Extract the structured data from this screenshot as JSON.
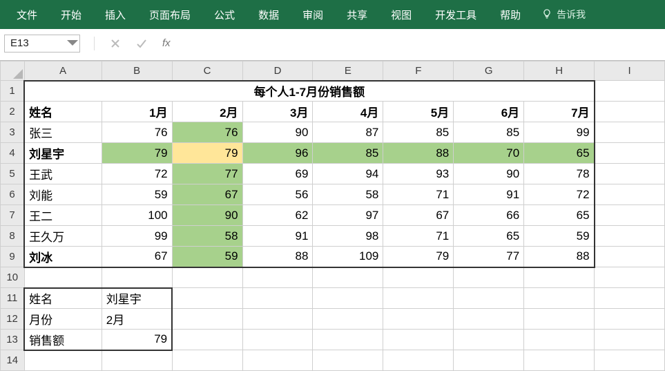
{
  "menu": {
    "items": [
      "文件",
      "开始",
      "插入",
      "页面布局",
      "公式",
      "数据",
      "审阅",
      "共享",
      "视图",
      "开发工具",
      "帮助"
    ],
    "tell_me": "告诉我"
  },
  "formula_bar": {
    "name_box": "E13",
    "fx_label": "fx",
    "formula": ""
  },
  "columns": [
    "A",
    "B",
    "C",
    "D",
    "E",
    "F",
    "G",
    "H",
    "I"
  ],
  "rows_count": 14,
  "title_row": {
    "text": "每个人1-7月份销售额"
  },
  "header_row": {
    "name_label": "姓名",
    "months": [
      "1月",
      "2月",
      "3月",
      "4月",
      "5月",
      "6月",
      "7月"
    ]
  },
  "data_rows": [
    {
      "name": "张三",
      "values": [
        76,
        76,
        90,
        87,
        85,
        85,
        99
      ]
    },
    {
      "name": "刘星宇",
      "values": [
        79,
        79,
        96,
        85,
        88,
        70,
        65
      ]
    },
    {
      "name": "王武",
      "values": [
        72,
        77,
        69,
        94,
        93,
        90,
        78
      ]
    },
    {
      "name": "刘能",
      "values": [
        59,
        67,
        56,
        58,
        71,
        91,
        72
      ]
    },
    {
      "name": "王二",
      "values": [
        100,
        90,
        62,
        97,
        67,
        66,
        65
      ]
    },
    {
      "name": "王久万",
      "values": [
        99,
        58,
        91,
        98,
        71,
        65,
        59
      ]
    },
    {
      "name": "刘冰",
      "values": [
        67,
        59,
        88,
        109,
        79,
        77,
        88
      ]
    }
  ],
  "highlight": {
    "green_column_index": 1,
    "green_row_index": 1,
    "yellow_cell": {
      "row": 1,
      "col": 1
    }
  },
  "lookup": {
    "rows": [
      {
        "label": "姓名",
        "value": "刘星宇",
        "align": "txt"
      },
      {
        "label": "月份",
        "value": "2月",
        "align": "txt"
      },
      {
        "label": "销售额",
        "value": "79",
        "align": "num"
      }
    ]
  },
  "colors": {
    "ribbon": "#1e6f46",
    "green": "#a7d18c",
    "yellow": "#ffe699"
  }
}
